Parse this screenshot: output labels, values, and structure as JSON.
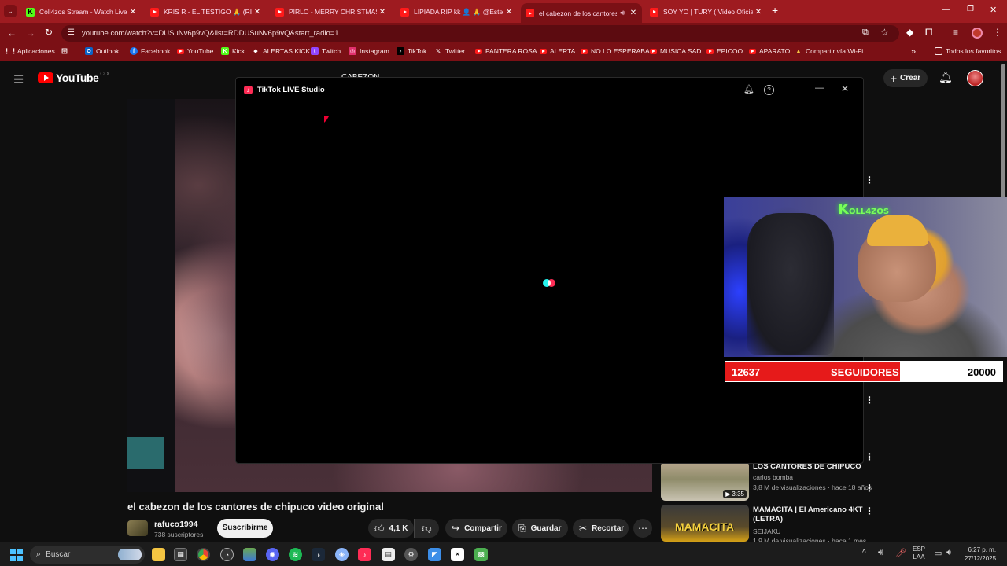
{
  "browser": {
    "tabs": [
      {
        "title": "Coll4zos Stream - Watch Live o",
        "icon": "kick-icon"
      },
      {
        "title": "KRIS R - EL TESTIGO 🙏 (RIP PI",
        "icon": "youtube-icon"
      },
      {
        "title": "PIRLO - MERRY CHRISTMAS 1 |",
        "icon": "youtube-icon"
      },
      {
        "title": "LIPIADA RIP kk 👤 🙏 @Esteba",
        "icon": "youtube-icon"
      },
      {
        "title": "el cabezon de los cantores",
        "icon": "youtube-icon"
      },
      {
        "title": "SOY YO | TURY ( Video Oficial )",
        "icon": "youtube-icon"
      }
    ],
    "new_tab": "+",
    "url": "youtube.com/watch?v=DUSuNv6p9vQ&list=RDDUSuNv6p9vQ&start_radio=1",
    "bookmarks": [
      {
        "label": "Aplicaciones",
        "icon": "apps-grid-icon"
      },
      {
        "label": "Outlook",
        "icon": "outlook-icon"
      },
      {
        "label": "Facebook",
        "icon": "facebook-icon"
      },
      {
        "label": "YouTube",
        "icon": "youtube-icon"
      },
      {
        "label": "Kick",
        "icon": "kick-icon"
      },
      {
        "label": "ALERTAS KICK",
        "icon": "diamond-icon"
      },
      {
        "label": "Twitch",
        "icon": "twitch-icon"
      },
      {
        "label": "Instagram",
        "icon": "instagram-icon"
      },
      {
        "label": "TikTok",
        "icon": "tiktok-icon"
      },
      {
        "label": "Twitter",
        "icon": "x-icon"
      },
      {
        "label": "PANTERA ROSA",
        "icon": "youtube-icon"
      },
      {
        "label": "ALERTA",
        "icon": "youtube-icon"
      },
      {
        "label": "NO LO ESPERABA",
        "icon": "youtube-icon"
      },
      {
        "label": "MUSICA SAD",
        "icon": "youtube-icon"
      },
      {
        "label": "EPICOO",
        "icon": "youtube-icon"
      },
      {
        "label": "APARATO",
        "icon": "youtube-icon"
      },
      {
        "label": "Compartir vía Wi-Fi",
        "icon": "wifi-share-icon"
      }
    ],
    "all_bookmarks": "Todos los favoritos",
    "overflow": "»"
  },
  "youtube": {
    "logo": "YouTube",
    "region": "CO",
    "search_value": "CABEZON",
    "create_label": "Crear",
    "video_title": "el cabezon de los cantores de chipuco video original",
    "channel_name": "rafuco1994",
    "subscribers": "738 suscriptores",
    "subscribe_label": "Suscribirme",
    "likes": "4,1 K",
    "share_label": "Compartir",
    "save_label": "Guardar",
    "clip_label": "Recortar",
    "suggestions": [
      {
        "title": "LOS CANTORES DE CHIPUCO",
        "channel": "carlos bomba",
        "meta": "3,8 M de visualizaciones · hace 18 años",
        "duration": "3:35"
      },
      {
        "title": "MAMACITA | El Americano 4KT (LETRA)",
        "channel": "SEIJAKU",
        "meta": "1,9 M de visualizaciones · hace 1 mes",
        "thumb_text": "MAMACITA"
      }
    ]
  },
  "tiktok_window": {
    "title": "TikTok LIVE Studio"
  },
  "overlay": {
    "brand": "K",
    "brand_rest": "OLL4ZOS",
    "followers_current": "12637",
    "followers_label": "SEGUIDORES",
    "followers_goal": "20000",
    "progress_fraction": 0.63
  },
  "taskbar": {
    "search_placeholder": "Buscar",
    "language": "ESP",
    "layout": "LAA",
    "time": "6:27 p. m.",
    "date": "27/12/2025"
  },
  "colors": {
    "chrome_frame": "#9e1b20",
    "chrome_toolbar": "#7b1015",
    "youtube_red": "#ff0000",
    "progress_red": "#e61a1a",
    "tiktok_pink": "#fe2c55",
    "tiktok_cyan": "#25f4ee"
  }
}
